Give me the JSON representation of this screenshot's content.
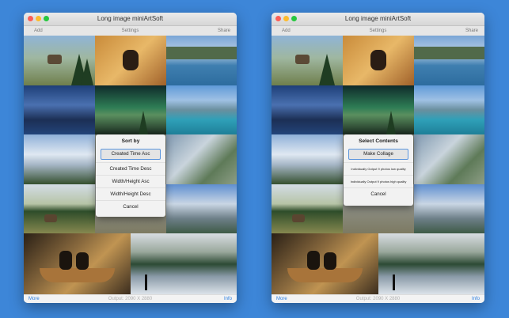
{
  "windows": [
    {
      "title": "Long image miniArtSoft",
      "toolbar": {
        "add": "Add",
        "settings": "Settings",
        "share": "Share"
      },
      "bottom": {
        "more": "More",
        "output": "Output: 2090 X 2880",
        "info": "Info"
      },
      "dialog": {
        "heading": "Sort by",
        "options": [
          "Created Time Asc",
          "Created Time Desc",
          "Width/Height Asc",
          "Width/Height Desc",
          "Cancel"
        ],
        "selected": "Created Time Asc"
      }
    },
    {
      "title": "Long image miniArtSoft",
      "toolbar": {
        "add": "Add",
        "settings": "Settings",
        "share": "Share"
      },
      "bottom": {
        "more": "More",
        "output": "Output: 2090 X 2880",
        "info": "Info"
      },
      "dialog": {
        "heading": "Select Contents",
        "options": [
          "Make Collage",
          "Individually Output 9 photos low quality",
          "Individually Output 9 photos high quality",
          "Cancel"
        ],
        "selected": "Make Collage"
      }
    }
  ],
  "colors": {
    "background": "#3d86d8",
    "link": "#2a7de1",
    "selection_border": "#5b95dc"
  }
}
